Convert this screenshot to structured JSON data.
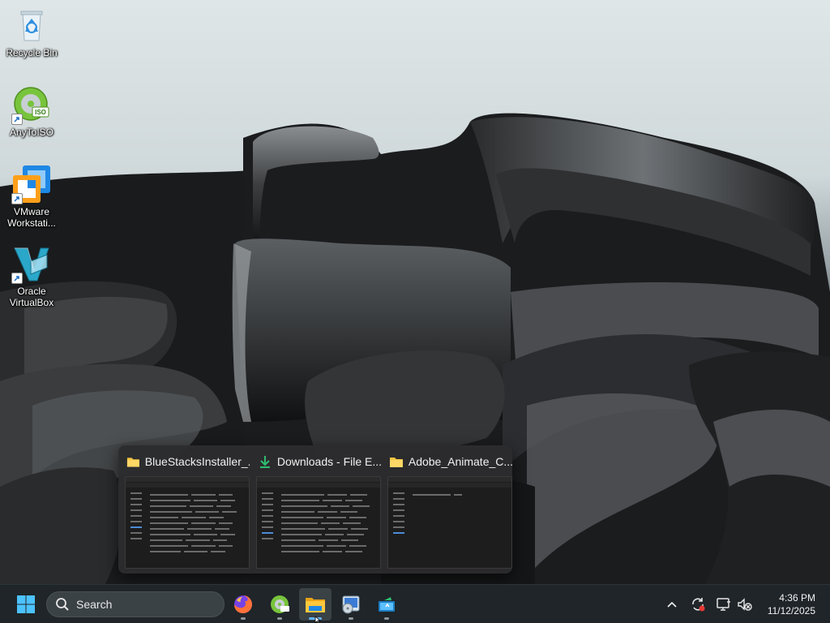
{
  "desktop": {
    "icons": [
      {
        "name": "Recycle Bin",
        "lines": [
          "Recycle Bin"
        ],
        "icon": "recycle-bin-icon"
      },
      {
        "name": "AnyToISO",
        "lines": [
          "AnyToISO"
        ],
        "icon": "anytoiso-icon"
      },
      {
        "name": "VMware Workstation",
        "lines": [
          "VMware",
          "Workstati..."
        ],
        "icon": "vmware-icon"
      },
      {
        "name": "Oracle VirtualBox",
        "lines": [
          "Oracle",
          "VirtualBox"
        ],
        "icon": "virtualbox-icon"
      }
    ]
  },
  "thumbnails": [
    {
      "title": "BlueStacksInstaller_...",
      "icon": "folder-icon"
    },
    {
      "title": "Downloads - File E...",
      "icon": "download-icon"
    },
    {
      "title": "Adobe_Animate_C...",
      "icon": "folder-icon"
    }
  ],
  "taskbar": {
    "search_label": "Search",
    "apps": [
      {
        "name": "Firefox",
        "icon": "firefox-icon",
        "active": false
      },
      {
        "name": "AnyToISO",
        "icon": "anytoiso-icon",
        "active": false
      },
      {
        "name": "File Explorer",
        "icon": "file-explorer-icon",
        "active": true
      },
      {
        "name": "Disc Utility",
        "icon": "disc-app-icon",
        "active": false
      },
      {
        "name": "Screen Capture",
        "icon": "capture-app-icon",
        "active": false
      }
    ],
    "tray": [
      "chevron-up-icon",
      "sync-icon",
      "display-icon",
      "speaker-muted-icon"
    ],
    "clock": {
      "time": "4:36 PM",
      "date": "11/12/2025"
    }
  },
  "colors": {
    "taskbar_bg": "#1f2529",
    "accent": "#5fb2ff",
    "search_bg": "#3b4246"
  }
}
